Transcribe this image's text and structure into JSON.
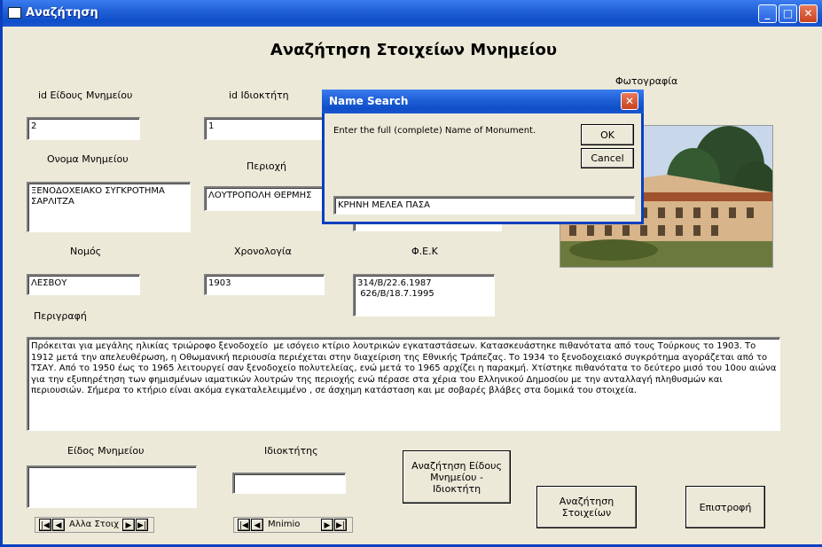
{
  "window": {
    "title": "Αναζήτηση"
  },
  "heading": "Αναζήτηση Στοιχείων Μνημείου",
  "fields": {
    "id_type": {
      "label": "id Είδους Μνημείου",
      "value": "2"
    },
    "id_owner": {
      "label": "id Ιδιοκτήτη",
      "value": "1"
    },
    "name": {
      "label": "Ονομα Μνημείου",
      "value": "ΞΕΝΟΔΟΧΕΙΑΚΟ ΣΥΓΚΡΟΤΗΜΑ\nΣΑΡΛΙΤΖΑ"
    },
    "region": {
      "label": "Περιοχή",
      "value": "ΛΟΥΤΡΟΠΟΛΗ ΘΕΡΜΗΣ"
    },
    "prefecture": {
      "label": "Νομός",
      "value": "ΛΕΣΒΟΥ"
    },
    "dating": {
      "label": "Χρονολογία",
      "value": "1903"
    },
    "fek": {
      "label": "Φ.Ε.Κ",
      "value": "314/Β/22.6.1987\n 626/Β/18.7.1995"
    },
    "description": {
      "label": "Περιγραφή",
      "value": "Πρόκειται για μεγάλης ηλικίας τριώροφο ξενοδοχείο  με ισόγειο κτίριο λουτρικών εγκαταστάσεων. Κατασκευάστηκε πιθανότατα από τους Τούρκους το 1903. Το 1912 μετά την απελευθέρωση, η Οθωμανική περιουσία περιέχεται στην διαχείριση της Εθνικής Τράπεζας. Το 1934 το ξενοδοχειακό συγκρότημα αγοράζεται από το ΤΣΑΥ. Από το 1950 έως το 1965 λειτουργεί σαν ξενοδοχείο πολυτελείας, ενώ μετά το 1965 αρχίζει η παρακμή. Χτίστηκε πιθανότατα το δεύτερο μισό του 10ου αιώνα για την εξυπηρέτηση των φημισμένων ιαματικών λουτρών της περιοχής ενώ πέρασε στα χέρια του Ελληνικού Δημοσίου με την ανταλλαγή πληθυσμών και περιουσιών. Σήμερα το κτήριο είναι ακόμα εγκαταλελειμμένο , σε άσχημη κατάσταση και με σοβαρές βλάβες στα δομικά του στοιχεία."
    },
    "monument_type": {
      "label": "Είδος Μνημείου",
      "value": ""
    },
    "owner": {
      "label": "Ιδιοκτήτης",
      "value": ""
    }
  },
  "photo_label": "Φωτογραφία",
  "nav1": {
    "caption": "Αλλα Στοιχ"
  },
  "nav2": {
    "caption": "Mnimio"
  },
  "buttons": {
    "search_type_owner": "Αναζήτηση Είδους Μνημείου -  Ιδιοκτήτη",
    "search_details": "Αναζήτηση Στοιχείων",
    "back": "Επιστροφή"
  },
  "dialog": {
    "title": "Name Search",
    "prompt": "Enter the full (complete) Name of Monument.",
    "ok": "OK",
    "cancel": "Cancel",
    "input": "ΚΡΗΝΗ ΜΕΛΕΑ ΠΑΣΑ"
  }
}
